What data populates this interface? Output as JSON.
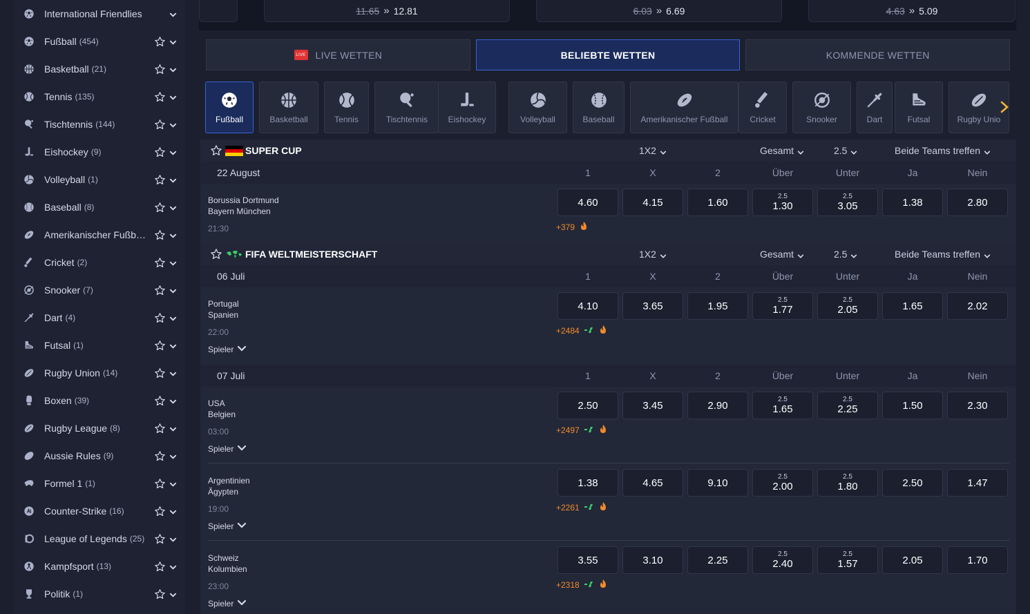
{
  "sidebar": {
    "items": [
      {
        "label": "International Friendlies",
        "count": "",
        "icon": "soccer-ball-icon",
        "star": false
      },
      {
        "label": "Fußball",
        "count": "(454)",
        "icon": "soccer-ball-icon",
        "star": true
      },
      {
        "label": "Basketball",
        "count": "(21)",
        "icon": "basketball-icon",
        "star": true
      },
      {
        "label": "Tennis",
        "count": "(135)",
        "icon": "tennis-ball-icon",
        "star": true
      },
      {
        "label": "Tischtennis",
        "count": "(144)",
        "icon": "table-tennis-icon",
        "star": true
      },
      {
        "label": "Eishockey",
        "count": "(9)",
        "icon": "ice-hockey-icon",
        "star": true
      },
      {
        "label": "Volleyball",
        "count": "(1)",
        "icon": "volleyball-icon",
        "star": true
      },
      {
        "label": "Baseball",
        "count": "(8)",
        "icon": "baseball-icon",
        "star": true
      },
      {
        "label": "Amerikanischer Fußball ...",
        "count": "",
        "icon": "american-football-icon",
        "star": true
      },
      {
        "label": "Cricket",
        "count": "(2)",
        "icon": "cricket-icon",
        "star": true
      },
      {
        "label": "Snooker",
        "count": "(7)",
        "icon": "snooker-icon",
        "star": true
      },
      {
        "label": "Dart",
        "count": "(4)",
        "icon": "dart-icon",
        "star": true
      },
      {
        "label": "Futsal",
        "count": "(1)",
        "icon": "futsal-icon",
        "star": true
      },
      {
        "label": "Rugby Union",
        "count": "(14)",
        "icon": "rugby-icon",
        "star": true
      },
      {
        "label": "Boxen",
        "count": "(39)",
        "icon": "boxing-icon",
        "star": true
      },
      {
        "label": "Rugby League",
        "count": "(8)",
        "icon": "rugby-icon",
        "star": true
      },
      {
        "label": "Aussie Rules",
        "count": "(9)",
        "icon": "aussie-rules-icon",
        "star": true
      },
      {
        "label": "Formel 1",
        "count": "(1)",
        "icon": "formula1-icon",
        "star": true
      },
      {
        "label": "Counter-Strike",
        "count": "(16)",
        "icon": "counter-strike-icon",
        "star": true
      },
      {
        "label": "League of Legends",
        "count": "(25)",
        "icon": "league-of-legends-icon",
        "star": true
      },
      {
        "label": "Kampfsport",
        "count": "(13)",
        "icon": "martial-arts-icon",
        "star": true
      },
      {
        "label": "Politik",
        "count": "(1)",
        "icon": "trophy-icon",
        "star": true
      }
    ]
  },
  "top_cards": [
    {
      "old": "11.65",
      "new": "12.81"
    },
    {
      "old": "6.03",
      "new": "6.69"
    },
    {
      "old": "4.63",
      "new": "5.09"
    }
  ],
  "tabs": {
    "live": "LIVE WETTEN",
    "live_badge": "LIVE",
    "popular": "BELIEBTE WETTEN",
    "upcoming": "KOMMENDE WETTEN"
  },
  "sports": [
    {
      "label": "Fußball",
      "icon": "soccer-ball-icon"
    },
    {
      "label": "Basketball",
      "icon": "basketball-icon"
    },
    {
      "label": "Tennis",
      "icon": "tennis-ball-icon"
    },
    {
      "label": "Tischtennis",
      "icon": "table-tennis-icon"
    },
    {
      "label": "Eishockey",
      "icon": "ice-hockey-icon"
    },
    {
      "label": "Volleyball",
      "icon": "volleyball-icon"
    },
    {
      "label": "Baseball",
      "icon": "baseball-icon"
    },
    {
      "label": "Amerikanischer Fußball",
      "icon": "american-football-icon"
    },
    {
      "label": "Cricket",
      "icon": "cricket-icon"
    },
    {
      "label": "Snooker",
      "icon": "snooker-icon"
    },
    {
      "label": "Dart",
      "icon": "dart-icon"
    },
    {
      "label": "Futsal",
      "icon": "futsal-icon"
    },
    {
      "label": "Rugby Unio",
      "icon": "rugby-icon"
    }
  ],
  "markets": {
    "m1x2": "1X2",
    "total": "Gesamt",
    "line": "2.5",
    "btts": "Beide Teams treffen"
  },
  "columns": [
    "1",
    "X",
    "2",
    "Über",
    "Unter",
    "Ja",
    "Nein"
  ],
  "spieler_label": "Spieler",
  "leagues": [
    {
      "name": "SUPER CUP",
      "flag": "germany",
      "dates": [
        {
          "date": "22 August",
          "matches": [
            {
              "home": "Borussia Dortmund",
              "away": "Bayern München",
              "time": "21:30",
              "more": "+379",
              "spieler": false,
              "odds": [
                "4.60",
                "4.15",
                "1.60",
                "1.30",
                "3.05",
                "1.38",
                "2.80"
              ],
              "line": "2.5"
            }
          ]
        }
      ]
    },
    {
      "name": "FIFA WELTMEISTERSCHAFT",
      "flag": "world",
      "dates": [
        {
          "date": "06 Juli",
          "matches": [
            {
              "home": "Portugal",
              "away": "Spanien",
              "time": "22:00",
              "more": "+2484",
              "spieler": true,
              "odds": [
                "4.10",
                "3.65",
                "1.95",
                "1.77",
                "2.05",
                "1.65",
                "2.02"
              ],
              "line": "2.5"
            }
          ]
        },
        {
          "date": "07 Juli",
          "matches": [
            {
              "home": "USA",
              "away": "Belgien",
              "time": "03:00",
              "more": "+2497",
              "spieler": true,
              "odds": [
                "2.50",
                "3.45",
                "2.90",
                "1.65",
                "2.25",
                "1.50",
                "2.30"
              ],
              "line": "2.5"
            },
            {
              "home": "Argentinien",
              "away": "Ägypten",
              "time": "19:00",
              "more": "+2261",
              "spieler": true,
              "odds": [
                "1.38",
                "4.65",
                "9.10",
                "2.00",
                "1.80",
                "2.50",
                "1.47"
              ],
              "line": "2.5"
            },
            {
              "home": "Schweiz",
              "away": "Kolumbien",
              "time": "23:00",
              "more": "+2318",
              "spieler": true,
              "odds": [
                "3.55",
                "3.10",
                "2.25",
                "2.40",
                "1.57",
                "2.05",
                "1.70"
              ],
              "line": "2.5"
            }
          ]
        }
      ]
    }
  ],
  "colors": {
    "accent_blue": "#3a64d6",
    "live_red": "#e13333",
    "fire_orange": "#f28a2b",
    "arrow_yellow": "#f2b233"
  }
}
